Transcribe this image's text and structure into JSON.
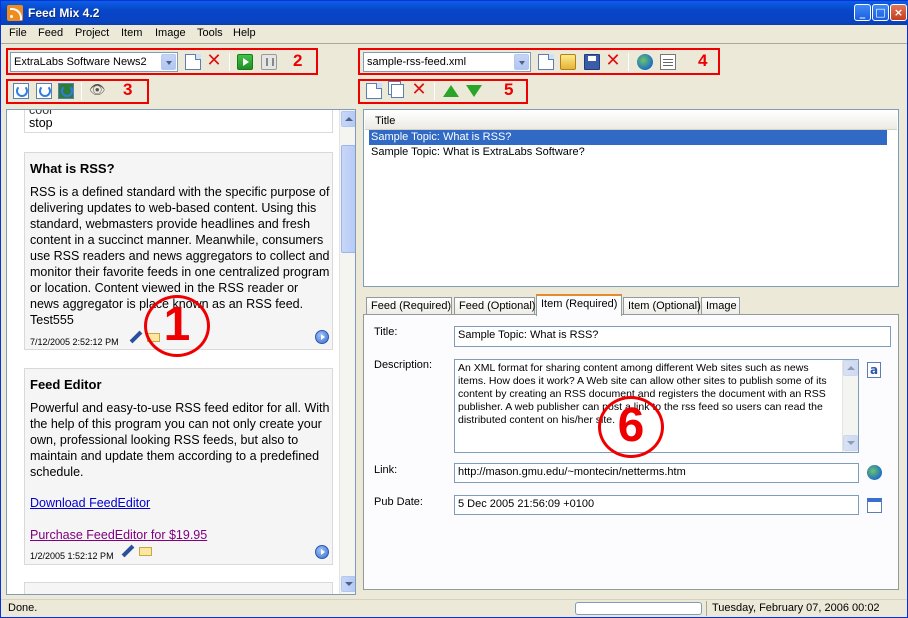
{
  "window": {
    "title": "Feed Mix 4.2",
    "min_label": "_",
    "max_label": "□",
    "close_label": "×"
  },
  "menu": [
    "File",
    "Feed",
    "Project",
    "Item",
    "Image",
    "Tools",
    "Help"
  ],
  "left_toolbar": {
    "feed_combo": "ExtraLabs Software News2",
    "annotation": "2"
  },
  "left_toolbar2": {
    "annotation": "3"
  },
  "right_toolbar": {
    "file_combo": "sample-rss-feed.xml",
    "annotation": "4"
  },
  "right_toolbar2": {
    "annotation": "5"
  },
  "preview": {
    "top_fragment_1": "cool",
    "top_fragment_2": "stop",
    "cards": [
      {
        "title": "What is RSS?",
        "body": "RSS is a defined standard with the specific purpose of delivering updates to web-based content. Using this standard, webmasters provide headlines and fresh content in a succinct manner. Meanwhile, consumers use RSS readers and news aggregators to collect and monitor their favorite feeds in one centralized program or location. Content viewed in the RSS reader or news aggregator is place known as an RSS feed. Test555",
        "date": "7/12/2005 2:52:12 PM"
      },
      {
        "title": "Feed Editor",
        "body": "Powerful and easy-to-use RSS feed editor for all. With the help of this program you can not only create your own, professional looking RSS feeds, but also to maintain and update them according to a predefined schedule.",
        "link1": "Download FeedEditor",
        "link2": "Purchase FeedEditor for $19.95",
        "date": "1/2/2005 1:52:12 PM"
      }
    ],
    "annotation": "1"
  },
  "items_list": {
    "header": "Title",
    "rows": [
      "Sample Topic: What is RSS?",
      "Sample Topic: What is ExtraLabs Software?"
    ]
  },
  "tabs": [
    "Feed (Required)",
    "Feed (Optional)",
    "Item (Required)",
    "Item (Optional)",
    "Image"
  ],
  "form": {
    "title_label": "Title:",
    "title_value": "Sample Topic: What is RSS?",
    "description_label": "Description:",
    "description_value": "An XML format for sharing content among different Web sites such as news items. How does it work? A Web site can allow other sites to publish some of its content by creating an RSS document and registers the document with an RSS publisher. A web publisher can post a link to the rss feed so users can read the distributed content on his/her site.",
    "link_label": "Link:",
    "link_value": "http://mason.gmu.edu/~montecin/netterms.htm",
    "pubdate_label": "Pub Date:",
    "pubdate_value": "5 Dec 2005 21:56:09 +0100",
    "annotation": "6"
  },
  "status": {
    "text": "Done.",
    "datetime": "Tuesday, February 07, 2006 00:02"
  }
}
